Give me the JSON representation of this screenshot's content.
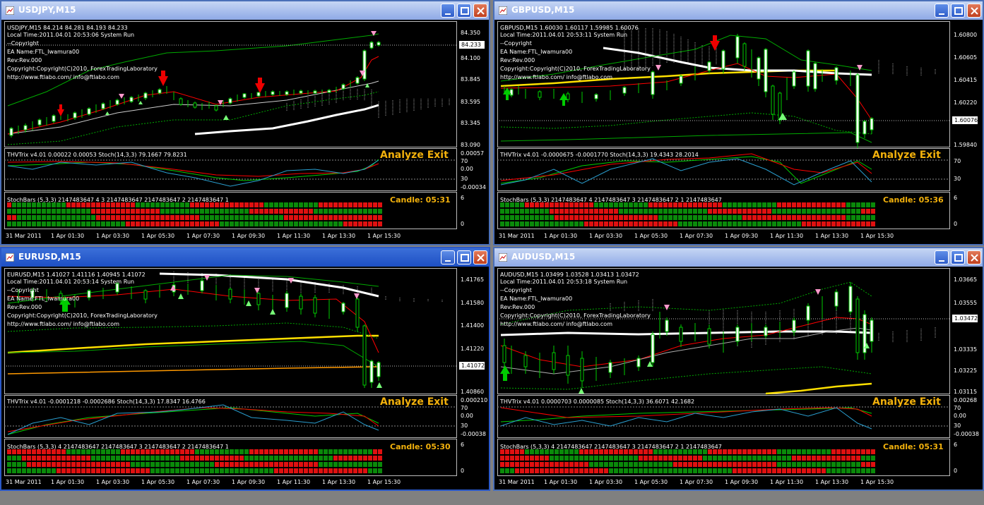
{
  "colors": {
    "bull": "#ffffff",
    "bear": "#000000",
    "wick": "#00cc00",
    "accent": "#f2b10c",
    "grid": "#9a9a9a"
  },
  "windows": [
    {
      "title": "USDJPY,M15",
      "header_lines": [
        "USDJPY,M15  84.214 84.281 84.193 84.233",
        "Local Time:2011.04.01 20:53:06 System Run",
        "--Copyright",
        "EA Name:FTL_Iwamura00",
        "Rev:Rev.000",
        "Copyright:Copyright(C)2010, ForexTradingLaboratory",
        "http://www.ftlabo.com/ info@ftlabo.com"
      ],
      "price_labels": [
        "84.350",
        "84.100",
        "83.845",
        "83.595",
        "83.345",
        "83.090"
      ],
      "current_price": "84.233",
      "indicator_text": "THVTrix v4.01 0.00022 0.00053  Stoch(14,3,3) 79.1667 79.8231",
      "indicator_labels": [
        "0.00057",
        "70",
        "0.00",
        "30",
        "-0.00034"
      ],
      "stochbars_text": "StochBars (5,3,3) 2147483647 4 3 2147483647 2147483647 2 2147483647 1",
      "stochbars_scale": [
        "6",
        "0"
      ],
      "analyze": "Analyze Exit",
      "candle": "Candle:  05:31",
      "time_labels": [
        "31 Mar 2011",
        "1 Apr 01:30",
        "1 Apr 03:30",
        "1 Apr 05:30",
        "1 Apr 07:30",
        "1 Apr 09:30",
        "1 Apr 11:30",
        "1 Apr 13:30",
        "1 Apr 15:30"
      ]
    },
    {
      "title": "GBPUSD,M15",
      "header_lines": [
        "GBPUSD,M15  1.60030 1.60117 1.59985 1.60076",
        "Local Time:2011.04.01 20:53:11 System Run",
        "--Copyright",
        "EA Name:FTL_Iwamura00",
        "Rev:Rev.000",
        "Copyright:Copyright(C)2010, ForexTradingLaboratory",
        "http://www.ftlabo.com/ info@ftlabo.com"
      ],
      "price_labels": [
        "1.60800",
        "1.60605",
        "1.60415",
        "1.60220",
        "1.60076",
        "1.59840"
      ],
      "current_price": "1.60076",
      "indicator_text": "THVTrix v4.01 -0.0000675 -0.0001770  Stoch(14,3,3) 19.4343 28.2014",
      "indicator_labels": [
        "70",
        "30"
      ],
      "stochbars_text": "StochBars (5,3,3) 2147483647 4 2147483647 3 2147483647 2 1 2147483647",
      "stochbars_scale": [
        "6",
        "0"
      ],
      "analyze": "Analyze Exit",
      "candle": "Candle:  05:36",
      "time_labels": [
        "31 Mar 2011",
        "1 Apr 01:30",
        "1 Apr 03:30",
        "1 Apr 05:30",
        "1 Apr 07:30",
        "1 Apr 09:30",
        "1 Apr 11:30",
        "1 Apr 13:30",
        "1 Apr 15:30"
      ]
    },
    {
      "title": "EURUSD,M15",
      "header_lines": [
        "EURUSD,M15  1.41027 1.41116 1.40945 1.41072",
        "Local Time:2011.04.01 20:53:14 System Run",
        "--Copyright",
        "EA Name:FTL_Iwamura00",
        "Rev:Rev.000",
        "Copyright:Copyright(C)2010, ForexTradingLaboratory",
        "http://www.ftlabo.com/ info@ftlabo.com"
      ],
      "price_labels": [
        "1.41765",
        "1.41580",
        "1.41400",
        "1.41220",
        "1.41072",
        "1.40860"
      ],
      "current_price": "1.41072",
      "indicator_text": "THVTrix v4.01 -0.0001218 -0.0002686  Stoch(14,3,3) 17.8347 16.4766",
      "indicator_labels": [
        "0.000210",
        "70",
        "0.00",
        "30",
        "-0.00038"
      ],
      "stochbars_text": "StochBars (5,3,3) 4 2147483647 2147483647 3 2147483647 2 2147483647 1",
      "stochbars_scale": [
        "6",
        "0"
      ],
      "analyze": "Analyze Exit",
      "candle": "Candle:  05:30",
      "time_labels": [
        "31 Mar 2011",
        "1 Apr 01:30",
        "1 Apr 03:30",
        "1 Apr 05:30",
        "1 Apr 07:30",
        "1 Apr 09:30",
        "1 Apr 11:30",
        "1 Apr 13:30",
        "1 Apr 15:30"
      ]
    },
    {
      "title": "AUDUSD,M15",
      "header_lines": [
        "AUDUSD,M15  1.03499 1.03528 1.03413 1.03472",
        "Local Time:2011.04.01 20:53:18 System Run",
        "--Copyright",
        "EA Name:FTL_Iwamura00",
        "Rev:Rev.000",
        "Copyright:Copyright(C)2010, ForexTradingLaboratory",
        "http://www.ftlabo.com/ info@ftlabo.com"
      ],
      "price_labels": [
        "1.03665",
        "1.03555",
        "1.03472",
        "1.03335",
        "1.03225",
        "1.03115"
      ],
      "current_price": "1.03472",
      "indicator_text": "THVTrix v4.01 0.0000703 0.0000085  Stoch(14,3,3) 36.6071 42.1682",
      "indicator_labels": [
        "0.00268",
        "70",
        "0.00",
        "30",
        "-0.00038"
      ],
      "stochbars_text": "StochBars (5,3,3) 4 2147483647 2147483647 3 2147483647 2 1 2147483647",
      "stochbars_scale": [
        "6",
        "0"
      ],
      "analyze": "Analyze Exit",
      "candle": "Candle:  05:31",
      "time_labels": [
        "31 Mar 2011",
        "1 Apr 01:30",
        "1 Apr 03:30",
        "1 Apr 05:30",
        "1 Apr 07:30",
        "1 Apr 09:30",
        "1 Apr 11:30",
        "1 Apr 13:30",
        "1 Apr 15:30"
      ]
    }
  ]
}
